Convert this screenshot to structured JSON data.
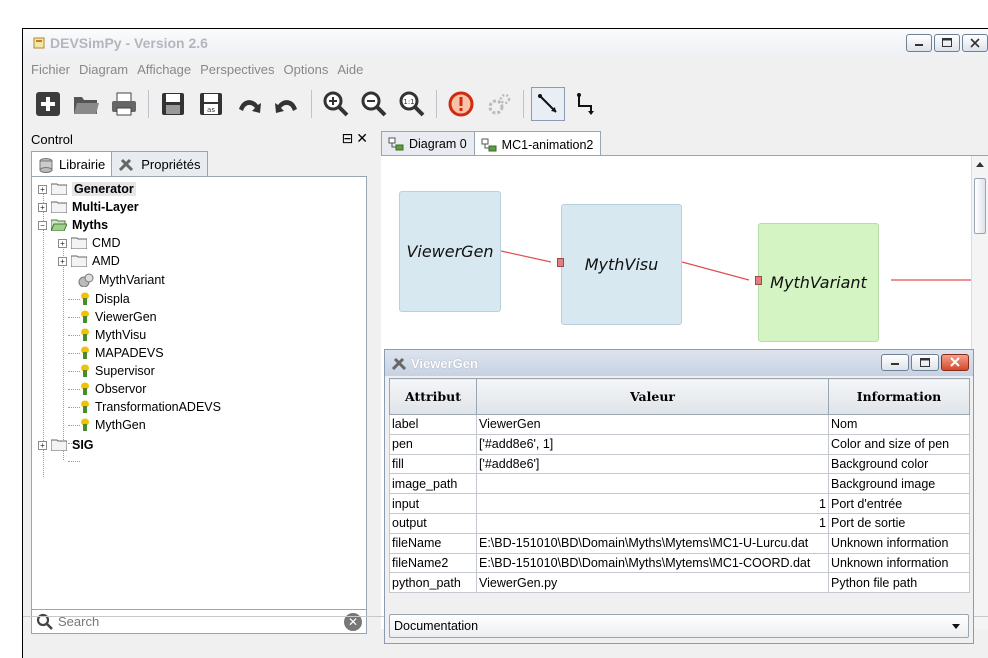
{
  "window": {
    "title": "DEVSimPy - Version 2.6"
  },
  "menu": [
    "Fichier",
    "Diagram",
    "Affichage",
    "Perspectives",
    "Options",
    "Aide"
  ],
  "toolbar": {
    "buttons": [
      "new-icon",
      "open-icon",
      "print-icon",
      "save-icon",
      "save-as-icon",
      "undo-icon",
      "redo-icon",
      "zoom-in-icon",
      "zoom-out-icon",
      "zoom-reset-icon",
      "stop-icon",
      "settings-icon",
      "direct-link-icon",
      "angle-link-icon"
    ],
    "selected": "direct-link-icon"
  },
  "control": {
    "title": "Control",
    "tabs": [
      "Librairie",
      "Propriétés"
    ],
    "active_tab": "Librairie",
    "tree": [
      {
        "label": "Generator",
        "bold": true,
        "highlight": true
      },
      {
        "label": "Multi-Layer",
        "bold": true
      },
      {
        "label": "Myths",
        "bold": true
      },
      {
        "label": "CMD"
      },
      {
        "label": "AMD"
      },
      {
        "label": "MythVariant"
      },
      {
        "label": "Displa"
      },
      {
        "label": "ViewerGen"
      },
      {
        "label": "MythVisu"
      },
      {
        "label": "MAPADEVS"
      },
      {
        "label": "Supervisor"
      },
      {
        "label": "Observor"
      },
      {
        "label": "TransformationADEVS"
      },
      {
        "label": "MythGen"
      },
      {
        "label": "SIG",
        "bold": true
      }
    ],
    "search": {
      "placeholder": "Search"
    }
  },
  "diagram": {
    "tabs": [
      "Diagram 0",
      "MC1-animation2"
    ],
    "active_tab": "MC1-animation2",
    "blocks": [
      "ViewerGen",
      "MythVisu",
      "MythVariant"
    ],
    "colors": {
      "block_blue": "#d7e8f0",
      "block_green": "#d4f4c4",
      "link": "#e05050"
    }
  },
  "properties": {
    "title": "ViewerGen",
    "columns": [
      "Attribut",
      "Valeur",
      "Information"
    ],
    "rows": [
      [
        "label",
        "ViewerGen",
        "Nom"
      ],
      [
        "pen",
        "['#add8e6', 1]",
        "Color and size of pen"
      ],
      [
        "fill",
        "['#add8e6']",
        "Background color"
      ],
      [
        "image_path",
        "",
        "Background image"
      ],
      [
        "input",
        "1",
        "Port d'entrée"
      ],
      [
        "output",
        "1",
        "Port de sortie"
      ],
      [
        "fileName",
        "E:\\BD-151010\\BD\\Domain\\Myths\\Mytems\\MC1-U-Lurcu.dat",
        "Unknown information"
      ],
      [
        "fileName2",
        "E:\\BD-151010\\BD\\Domain\\Myths\\Mytems\\MC1-COORD.dat",
        "Unknown information"
      ],
      [
        "python_path",
        "ViewerGen.py",
        "Python file path"
      ]
    ],
    "combo": "Documentation"
  }
}
